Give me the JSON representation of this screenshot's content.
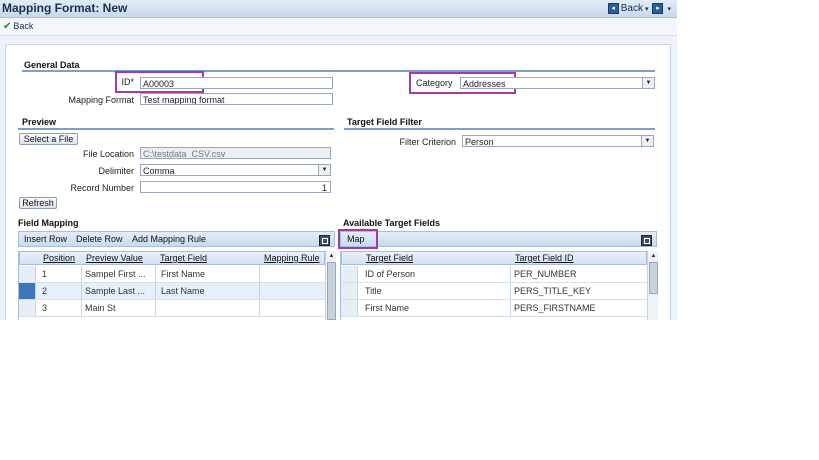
{
  "window": {
    "title": "Mapping Format: New",
    "back_label": "Back",
    "nav_back_label": "Back",
    "nav_back_icon": "back-square-icon",
    "nav_forward_icon": "forward-square-icon",
    "dropdown_glyph": "▾"
  },
  "general": {
    "section_title": "General Data",
    "id_label": "ID*",
    "id_value": "A00003",
    "mapping_format_label": "Mapping Format",
    "mapping_format_value": "Test mapping format",
    "category_label": "Category",
    "category_value": "Addresses"
  },
  "preview": {
    "section_title": "Preview",
    "select_file_label": "Select a File",
    "file_location_label": "File Location",
    "file_location_value": "C:\\testdata_CSV.csv",
    "delimiter_label": "Delimiter",
    "delimiter_value": "Comma",
    "record_number_label": "Record Number",
    "record_number_value": "1",
    "refresh_label": "Refresh"
  },
  "target_filter": {
    "section_title": "Target Field Filter",
    "filter_criterion_label": "Filter Criterion",
    "filter_criterion_value": "Person"
  },
  "field_mapping": {
    "section_title": "Field Mapping",
    "toolbar": {
      "insert_row": "Insert Row",
      "delete_row": "Delete Row",
      "add_mapping_rule": "Add Mapping Rule"
    },
    "columns": [
      "Position",
      "Preview Value",
      "Target Field",
      "Mapping Rule"
    ],
    "rows": [
      {
        "position": "1",
        "preview_value": "Sampel First ...",
        "target_field": "First Name",
        "mapping_rule": ""
      },
      {
        "position": "2",
        "preview_value": "Sample Last ...",
        "target_field": "Last Name",
        "mapping_rule": ""
      },
      {
        "position": "3",
        "preview_value": "Main St",
        "target_field": "",
        "mapping_rule": ""
      }
    ]
  },
  "available_fields": {
    "section_title": "Available Target Fields",
    "toolbar": {
      "map": "Map"
    },
    "columns": [
      "Target Field",
      "Target Field ID"
    ],
    "rows": [
      {
        "target_field": "ID of Person",
        "target_field_id": "PER_NUMBER"
      },
      {
        "target_field": "Title",
        "target_field_id": "PERS_TITLE_KEY"
      },
      {
        "target_field": "First Name",
        "target_field_id": "PERS_FIRSTNAME"
      }
    ]
  },
  "colors": {
    "highlight": "#a23aa8",
    "section_line": "#7ea0c8",
    "selected_row": "#3e74b8"
  }
}
